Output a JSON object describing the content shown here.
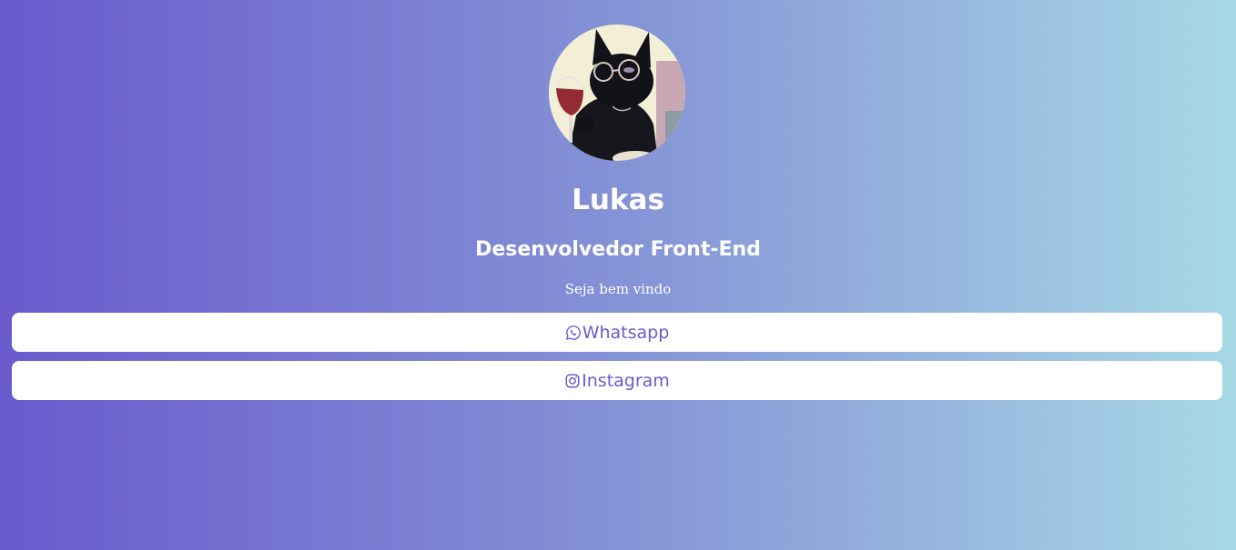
{
  "profile": {
    "name": "Lukas",
    "role": "Desenvolvedor Front-End",
    "welcome": "Seja bem vindo",
    "avatar_icon": "black-cat-with-glasses-avatar"
  },
  "links": {
    "whatsapp": {
      "label": "Whatsapp",
      "icon": "whatsapp-icon"
    },
    "instagram": {
      "label": "Instagram",
      "icon": "instagram-icon"
    }
  },
  "colors": {
    "gradient_start": "#6a5acd",
    "gradient_end": "#a8d8e6",
    "button_bg": "#ffffff",
    "button_text": "#6a5acd",
    "text": "#ffffff"
  }
}
